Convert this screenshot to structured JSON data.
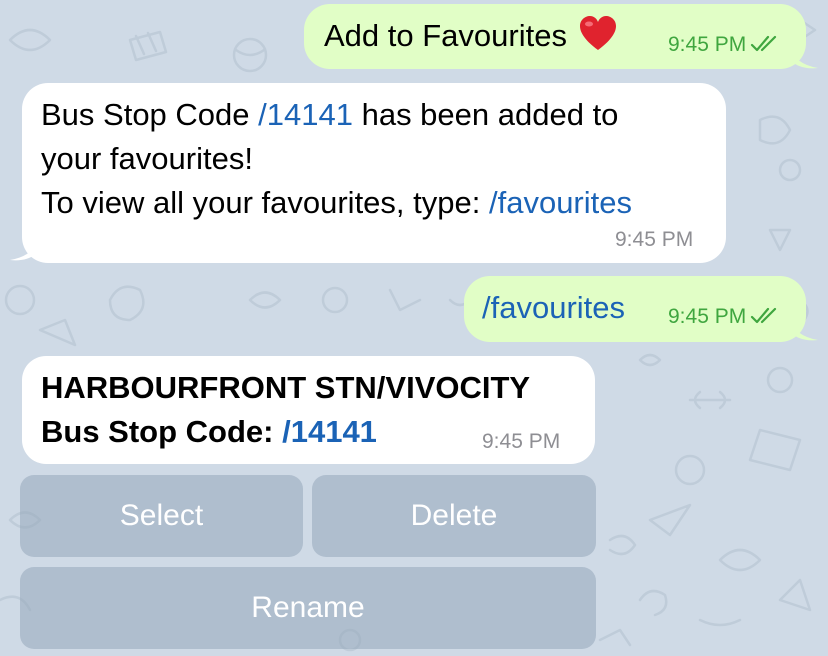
{
  "theme": {
    "chat_background": "#cfdae6",
    "outgoing_bubble": "#e1fec6",
    "incoming_bubble": "#ffffff",
    "link_color": "#1b63b6",
    "outgoing_time_color": "#3fa63f",
    "incoming_time_color": "#8e8e93",
    "keyboard_button": "#96a8ba"
  },
  "messages": [
    {
      "direction": "outgoing",
      "text": "Add to Favourites",
      "emoji_icon": "red-heart-icon",
      "time": "9:45 PM",
      "status_icon": "double-check-icon"
    },
    {
      "direction": "incoming",
      "line1_prefix": "Bus Stop Code ",
      "line1_link": "/14141",
      "line1_suffix": " has been added to",
      "line2": "your favourites!",
      "line3_prefix": "To view all your favourites, type: ",
      "line3_link": "/favourites",
      "time": "9:45 PM"
    },
    {
      "direction": "outgoing",
      "link": "/favourites",
      "time": "9:45 PM",
      "status_icon": "double-check-icon"
    },
    {
      "direction": "incoming",
      "title": "HARBOURFRONT STN/VIVOCITY",
      "code_label": "Bus Stop Code: ",
      "code_link": "/14141",
      "time": "9:45 PM"
    }
  ],
  "inline_keyboard": {
    "select": "Select",
    "delete": "Delete",
    "rename": "Rename"
  }
}
